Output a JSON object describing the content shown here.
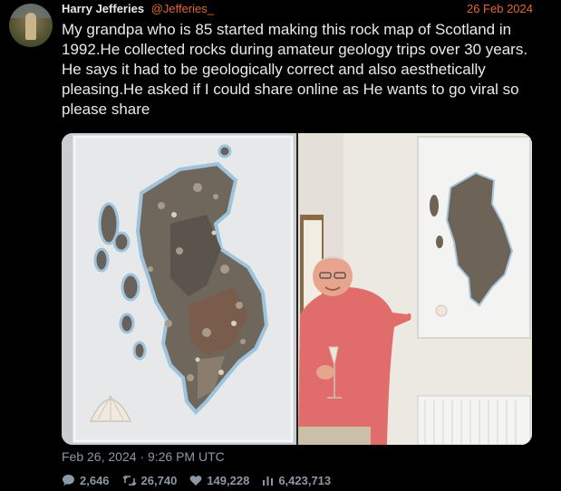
{
  "tweet": {
    "author_name": "Harry Jefferies",
    "author_handle": "@Jefferies_",
    "date": "26 Feb 2024",
    "text": "My grandpa who is 85 started making this rock map of Scotland in 1992.He collected rocks during amateur geology trips over 30 years. He says it had to be geologically correct and also aesthetically pleasing.He asked if I could share online as He wants to go viral so please share",
    "timestamp": "Feb 26, 2024 · 9:26 PM UTC",
    "stats": {
      "replies": "2,646",
      "retweets": "26,740",
      "likes": "149,228",
      "views": "6,423,713"
    }
  },
  "icons": {
    "reply": "speech-bubble-icon",
    "retweet": "retweet-arrows-icon",
    "like": "heart-icon",
    "views": "bar-chart-icon"
  },
  "colors": {
    "background": "#000000",
    "text": "#e7e9ea",
    "accent": "#e06830",
    "muted": "#8b98a5"
  }
}
